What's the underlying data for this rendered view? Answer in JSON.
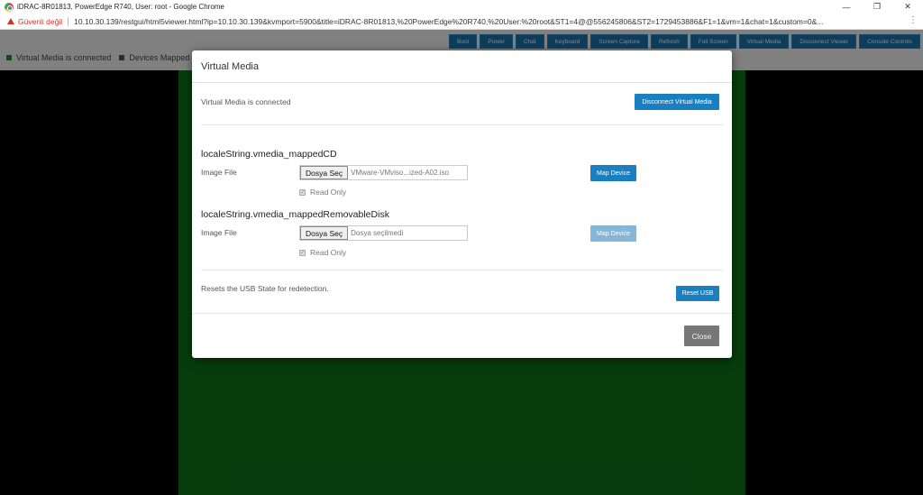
{
  "window": {
    "title": "iDRAC-8R01813, PowerEdge R740, User: root - Google Chrome",
    "minimize_icon": "minimize-icon",
    "maximize_icon": "maximize-icon",
    "close_icon": "close-icon"
  },
  "addressbar": {
    "security_label": "Güvenli değil",
    "url": "10.10.30.139/restgui/html5viewer.html?ip=10.10.30.139&kvmport=5900&title=iDRAC-8R01813,%20PowerEdge%20R740,%20User:%20root&ST1=4@@556245806&ST2=1729453886&F1=1&vm=1&chat=1&custom=0&..."
  },
  "toolbar": {
    "buttons": [
      "Boot",
      "Power",
      "Chat",
      "Keyboard",
      "Screen Capture",
      "Refresh",
      "Full Screen",
      "Virtual Media",
      "Disconnect Viewer",
      "Console Controls"
    ]
  },
  "status": {
    "vm_connected": "Virtual Media is connected",
    "devices_mapped": "Devices Mapped",
    "vm_color": "#1f8b2a",
    "devices_color": "#555555"
  },
  "modal": {
    "title": "Virtual Media",
    "connection_text": "Virtual Media is connected",
    "disconnect_label": "Disconnect Virtual Media",
    "cd": {
      "title": "localeString.vmedia_mappedCD",
      "image_label": "Image File",
      "choose_label": "Dosya Seç",
      "file_name": "VMware-VMviso...ized-A02.iso",
      "read_only": "Read Only",
      "map_label": "Map Device"
    },
    "disk": {
      "title": "localeString.vmedia_mappedRemovableDisk",
      "image_label": "Image File",
      "choose_label": "Dosya Seç",
      "file_name": "Dosya seçilmedi",
      "read_only": "Read Only",
      "map_label": "Map Device"
    },
    "reset_text": "Resets the USB State for redetection.",
    "reset_label": "Reset USB",
    "close_label": "Close"
  }
}
